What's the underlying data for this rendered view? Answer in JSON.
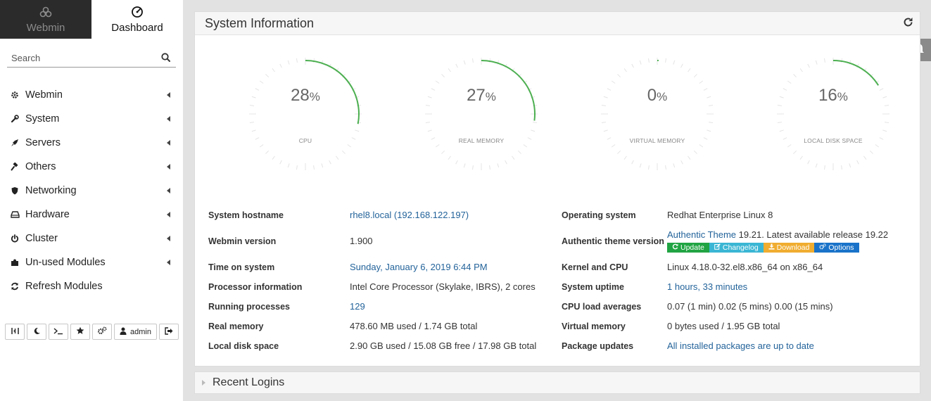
{
  "switcher": {
    "webmin_label": "Webmin",
    "dashboard_label": "Dashboard"
  },
  "search": {
    "placeholder": "Search"
  },
  "menu": [
    {
      "label": "Webmin",
      "icon": "gear-icon"
    },
    {
      "label": "System",
      "icon": "wrench-icon"
    },
    {
      "label": "Servers",
      "icon": "rocket-icon"
    },
    {
      "label": "Others",
      "icon": "gavel-icon"
    },
    {
      "label": "Networking",
      "icon": "shield-icon"
    },
    {
      "label": "Hardware",
      "icon": "hdd-icon"
    },
    {
      "label": "Cluster",
      "icon": "power-icon"
    },
    {
      "label": "Un-used Modules",
      "icon": "puzzle-icon"
    },
    {
      "label": "Refresh Modules",
      "icon": "refresh-icon"
    }
  ],
  "bottombar": {
    "user_label": "admin"
  },
  "panel": {
    "title": "System Information"
  },
  "gauges": [
    {
      "value": "28",
      "unit": "%",
      "label": "CPU",
      "fraction": 0.28
    },
    {
      "value": "27",
      "unit": "%",
      "label": "REAL MEMORY",
      "fraction": 0.27
    },
    {
      "value": "0",
      "unit": "%",
      "label": "VIRTUAL MEMORY",
      "fraction": 0.0
    },
    {
      "value": "16",
      "unit": "%",
      "label": "LOCAL DISK SPACE",
      "fraction": 0.16
    }
  ],
  "info_left": [
    {
      "key": "System hostname",
      "value": "rhel8.local (192.168.122.197)",
      "link": true
    },
    {
      "key": "Webmin version",
      "value": "1.900",
      "link": false
    },
    {
      "key": "Time on system",
      "value": "Sunday, January 6, 2019 6:44 PM",
      "link": true
    },
    {
      "key": "Processor information",
      "value": "Intel Core Processor (Skylake, IBRS), 2 cores",
      "link": false
    },
    {
      "key": "Running processes",
      "value": "129",
      "link": true
    },
    {
      "key": "Real memory",
      "value": "478.60 MB used / 1.74 GB total",
      "link": false
    },
    {
      "key": "Local disk space",
      "value": "2.90 GB used / 15.08 GB free / 17.98 GB total",
      "link": false
    }
  ],
  "info_right": {
    "os": {
      "key": "Operating system",
      "value": "Redhat Enterprise Linux 8"
    },
    "theme": {
      "key": "Authentic theme version",
      "link_text": "Authentic Theme",
      "version_text": " 19.21. Latest available release 19.22"
    },
    "badges": {
      "update": "Update",
      "changelog": "Changelog",
      "download": "Download",
      "options": "Options"
    },
    "rows": [
      {
        "key": "Kernel and CPU",
        "value": "Linux 4.18.0-32.el8.x86_64 on x86_64",
        "link": false
      },
      {
        "key": "System uptime",
        "value": "1 hours, 33 minutes",
        "link": true
      },
      {
        "key": "CPU load averages",
        "value": "0.07 (1 min) 0.02 (5 mins) 0.00 (15 mins)",
        "link": false
      },
      {
        "key": "Virtual memory",
        "value": "0 bytes used / 1.95 GB total",
        "link": false
      },
      {
        "key": "Package updates",
        "value": "All installed packages are up to date",
        "link": true
      }
    ]
  },
  "recent_logins": {
    "title": "Recent Logins"
  },
  "colors": {
    "gauge_arc": "#4caf50",
    "link": "#23639a"
  }
}
